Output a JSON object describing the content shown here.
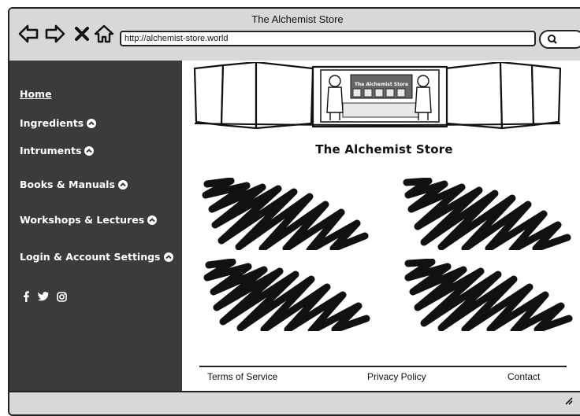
{
  "window": {
    "title": "The Alchemist Store"
  },
  "toolbar": {
    "back_icon": "back-arrow-icon",
    "forward_icon": "forward-arrow-icon",
    "close_icon": "close-x-icon",
    "home_icon": "home-icon",
    "url": "http://alchemist-store.world",
    "search_icon": "search-icon"
  },
  "sidebar": {
    "items": [
      {
        "label": "Home"
      },
      {
        "label": "Ingredients"
      },
      {
        "label": "Intruments"
      },
      {
        "label": "Books & Manuals"
      },
      {
        "label": "Workshops & Lectures"
      },
      {
        "label": "Login & Account Settings"
      }
    ],
    "social_icons": [
      "facebook-icon",
      "twitter-icon",
      "instagram-icon"
    ]
  },
  "main": {
    "banner": {
      "sign_text": "The Alchemist Store"
    },
    "title": "The Alchemist Store"
  },
  "footer": {
    "links": [
      "Terms of Service",
      "Privacy Policy",
      "Contact"
    ]
  },
  "colors": {
    "sidebar_bg": "#3b3b3b",
    "chrome_bg": "#d8d8d8",
    "ink": "#222222"
  }
}
